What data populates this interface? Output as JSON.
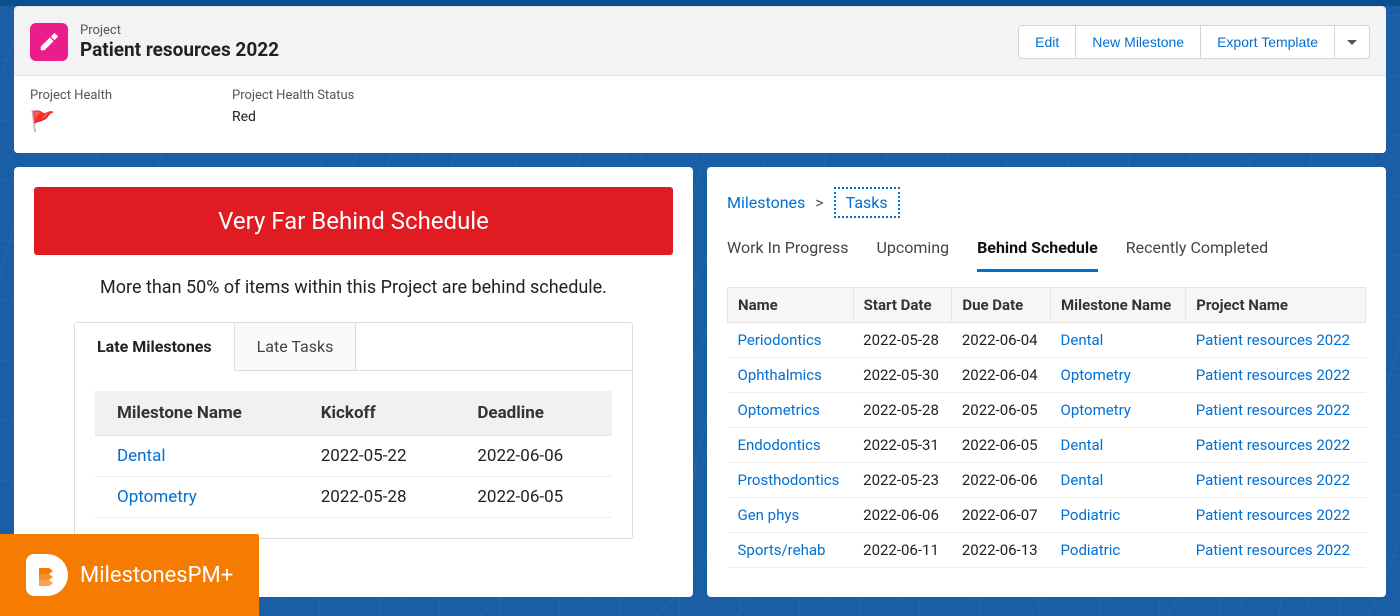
{
  "header": {
    "type_label": "Project",
    "title": "Patient resources 2022",
    "actions": {
      "edit": "Edit",
      "new_milestone": "New Milestone",
      "export_template": "Export Template"
    },
    "project_health_label": "Project Health",
    "project_health_status_label": "Project Health Status",
    "project_health_status_value": "Red",
    "flag_icon": "🚩"
  },
  "alert": {
    "banner": "Very Far Behind Schedule",
    "subtext": "More than 50% of items within this Project are behind schedule."
  },
  "late_tabs": {
    "milestones_label": "Late Milestones",
    "tasks_label": "Late Tasks",
    "active": "milestones",
    "columns": {
      "name": "Milestone Name",
      "kickoff": "Kickoff",
      "deadline": "Deadline"
    },
    "rows": [
      {
        "name": "Dental",
        "kickoff": "2022-05-22",
        "deadline": "2022-06-06"
      },
      {
        "name": "Optometry",
        "kickoff": "2022-05-28",
        "deadline": "2022-06-05"
      }
    ]
  },
  "right": {
    "breadcrumb": {
      "milestones": "Milestones",
      "sep": ">",
      "tasks": "Tasks"
    },
    "subtabs": {
      "wip": "Work In Progress",
      "upcoming": "Upcoming",
      "behind": "Behind Schedule",
      "recent": "Recently Completed",
      "active": "behind"
    },
    "columns": {
      "name": "Name",
      "start": "Start Date",
      "due": "Due Date",
      "milestone": "Milestone Name",
      "project": "Project Name"
    },
    "rows": [
      {
        "name": "Periodontics",
        "start": "2022-05-28",
        "due": "2022-06-04",
        "milestone": "Dental",
        "project": "Patient resources 2022"
      },
      {
        "name": "Ophthalmics",
        "start": "2022-05-30",
        "due": "2022-06-04",
        "milestone": "Optometry",
        "project": "Patient resources 2022"
      },
      {
        "name": "Optometrics",
        "start": "2022-05-28",
        "due": "2022-06-05",
        "milestone": "Optometry",
        "project": "Patient resources 2022"
      },
      {
        "name": "Endodontics",
        "start": "2022-05-31",
        "due": "2022-06-05",
        "milestone": "Dental",
        "project": "Patient resources 2022"
      },
      {
        "name": "Prosthodontics",
        "start": "2022-05-23",
        "due": "2022-06-06",
        "milestone": "Dental",
        "project": "Patient resources 2022"
      },
      {
        "name": "Gen phys",
        "start": "2022-06-06",
        "due": "2022-06-07",
        "milestone": "Podiatric",
        "project": "Patient resources 2022"
      },
      {
        "name": "Sports/rehab",
        "start": "2022-06-11",
        "due": "2022-06-13",
        "milestone": "Podiatric",
        "project": "Patient resources 2022"
      }
    ]
  },
  "logo": {
    "text": "MilestonesPM+"
  }
}
